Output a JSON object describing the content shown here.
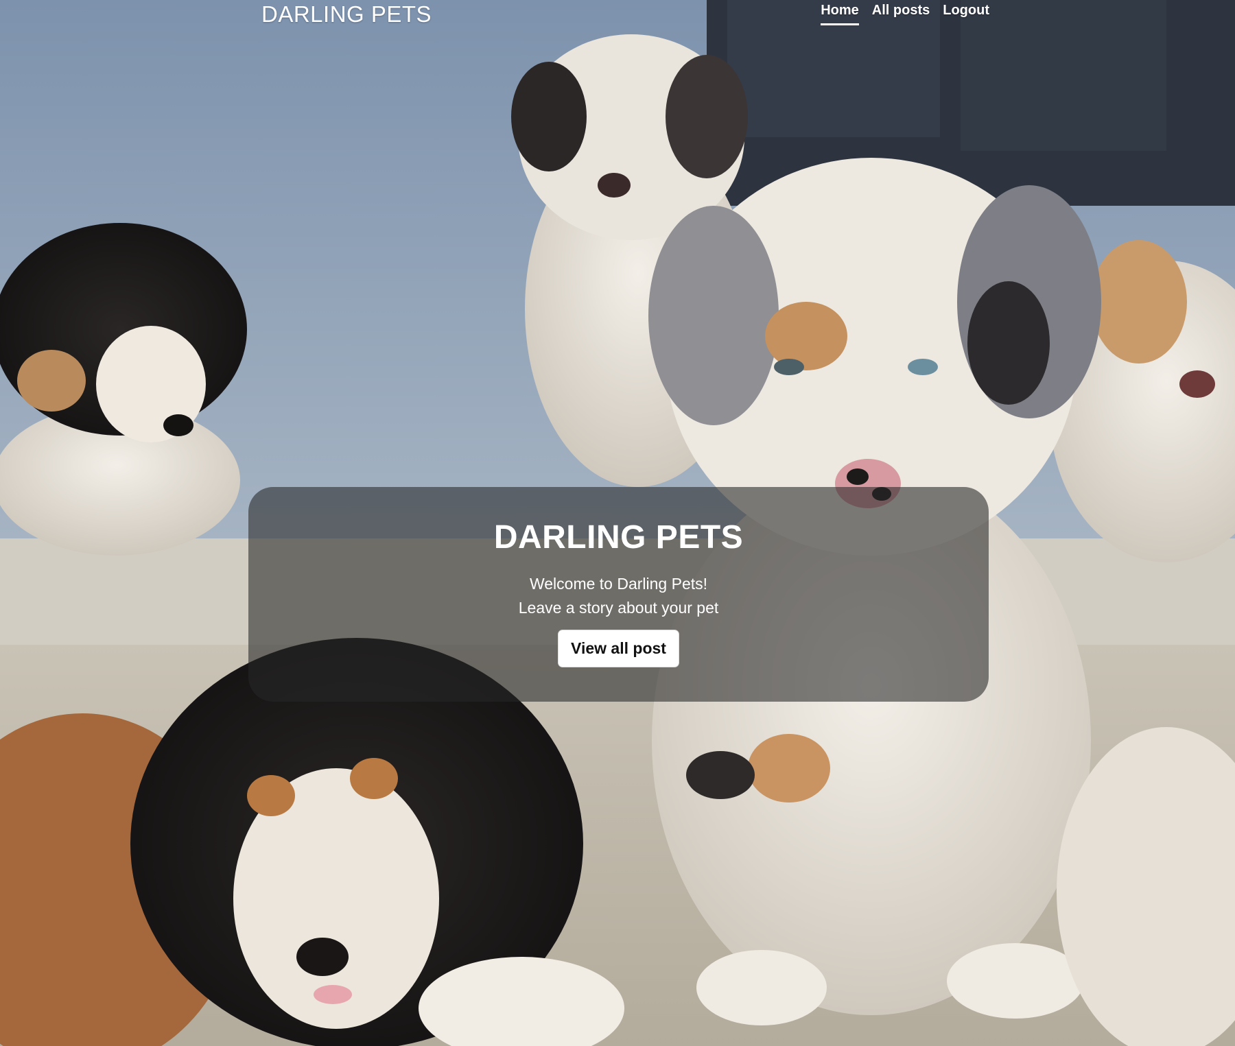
{
  "navbar": {
    "brand": "DARLING PETS",
    "links": [
      {
        "label": "Home",
        "active": true
      },
      {
        "label": "All posts",
        "active": false
      },
      {
        "label": "Logout",
        "active": false
      }
    ]
  },
  "hero": {
    "title": "DARLING PETS",
    "lines": [
      "Welcome to Darling Pets!",
      "Leave a story about your pet"
    ],
    "button_label": "View all post"
  },
  "colors": {
    "overlay": "#282828",
    "button_bg": "#ffffff",
    "text": "#ffffff"
  }
}
